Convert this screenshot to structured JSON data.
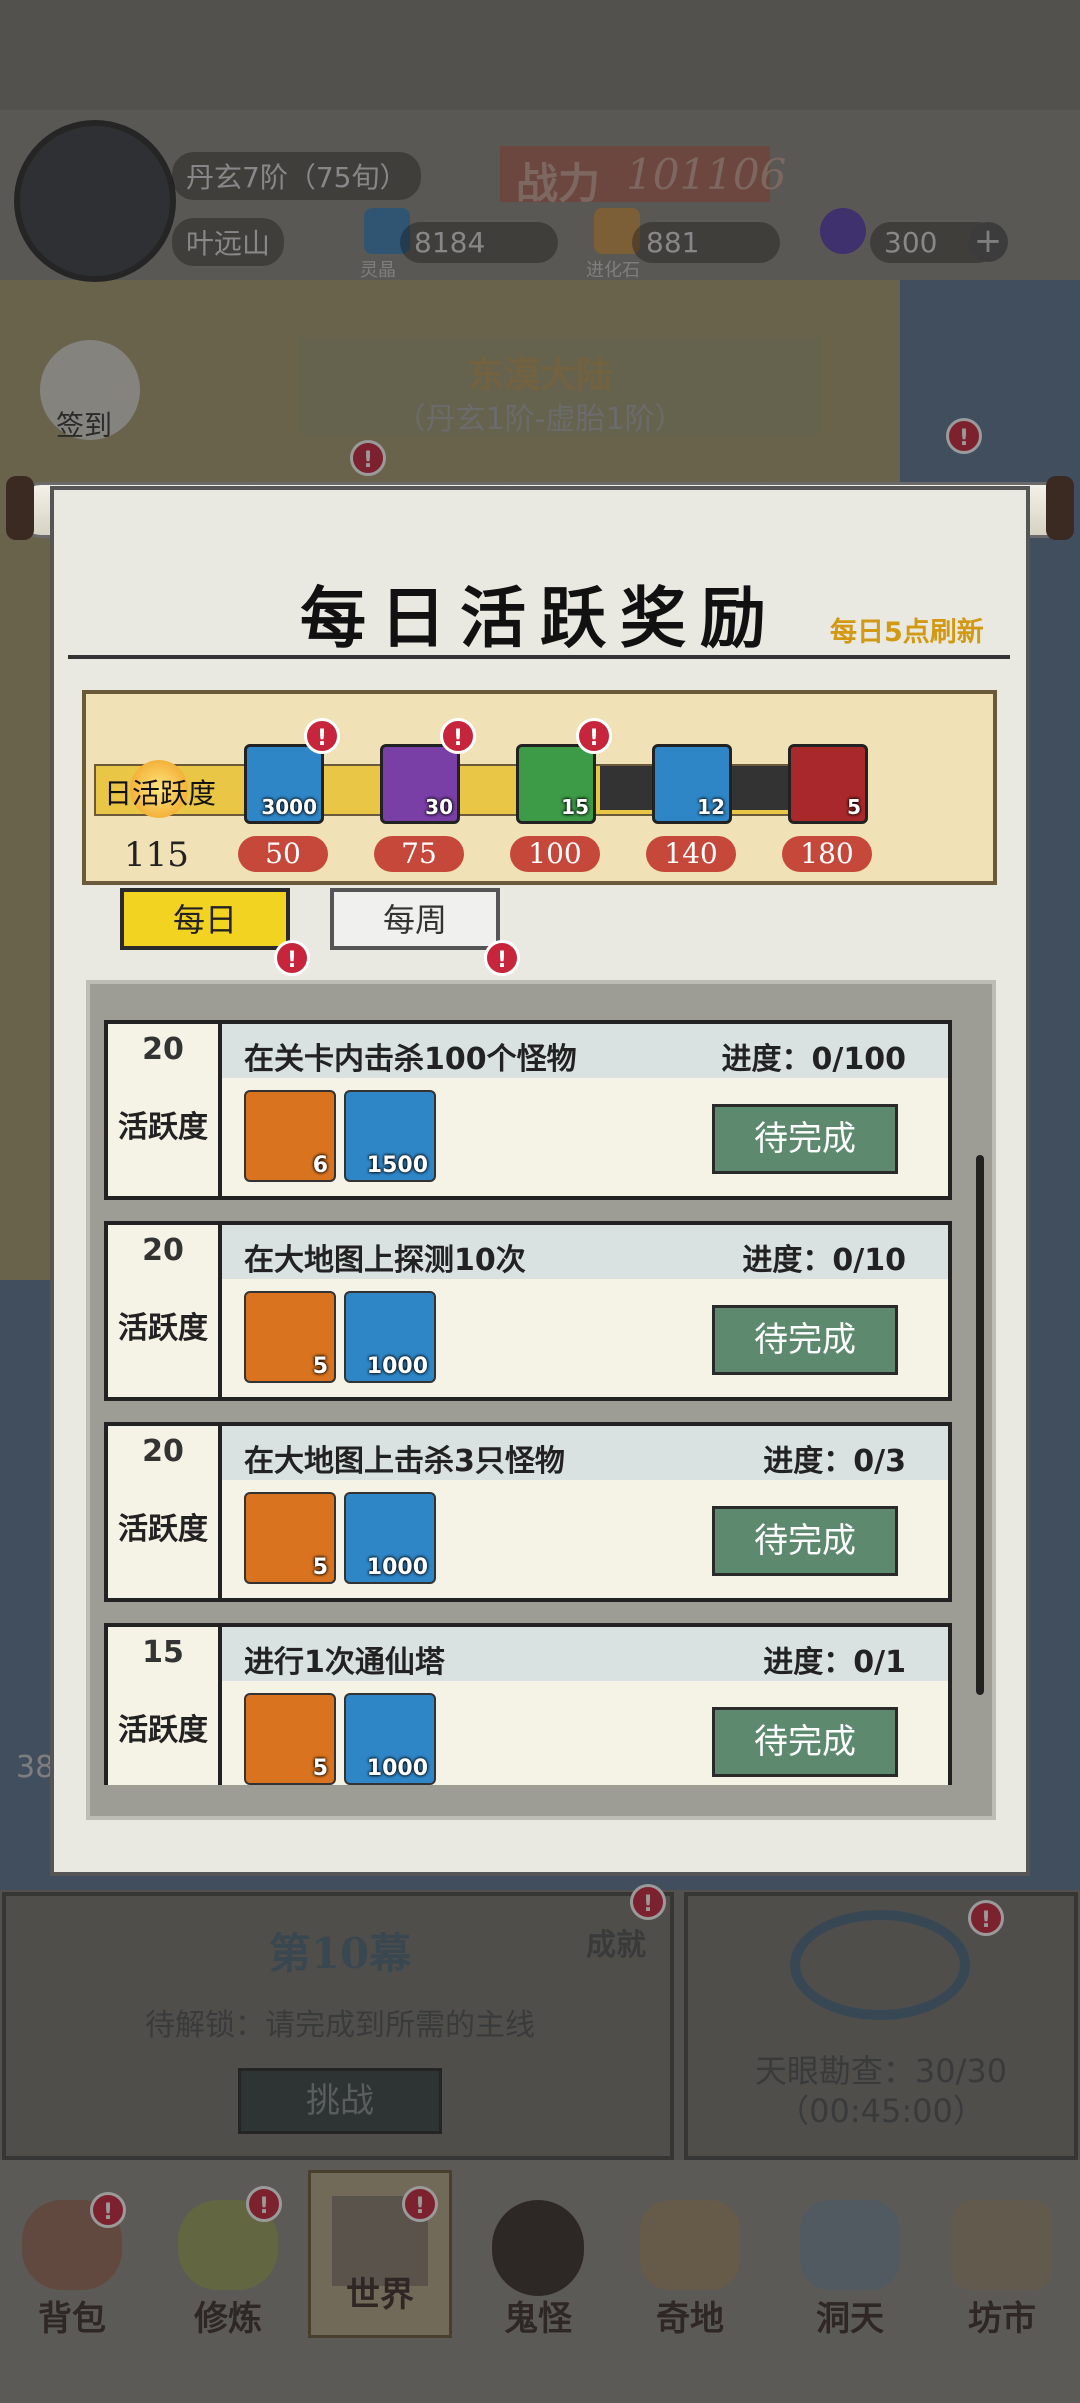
{
  "colors": {
    "accent": "#f2d321",
    "button": "#5d8a6f",
    "alert": "#c7253b",
    "threshold": "#c5483a",
    "gold": "#d29a14"
  },
  "hud": {
    "realm": "丹玄7阶（75旬）",
    "name": "叶远山",
    "power_label": "战力",
    "power_value": "101106",
    "res1_label": "灵晶",
    "res1_value": "8184",
    "res2_label": "进化石",
    "res2_value": "881",
    "res3_value": "300",
    "checkin": "签到"
  },
  "map": {
    "region": "东漠大陆",
    "region_sub": "（丹玄1阶-虚胎1阶）",
    "left_num": "38"
  },
  "modal": {
    "title": "每日活跃奖励",
    "refresh": "每日5点刷新",
    "active_label": "日活跃度",
    "active_value": "115",
    "milestones": [
      {
        "threshold": "50",
        "count": "3000",
        "icon": "crystal-icon",
        "color": "#2f86c6"
      },
      {
        "threshold": "75",
        "count": "30",
        "icon": "herb-icon",
        "color": "#7a3fa6"
      },
      {
        "threshold": "100",
        "count": "15",
        "icon": "mystery-box-icon",
        "color": "#3d9a46"
      },
      {
        "threshold": "140",
        "count": "12",
        "icon": "jade-icon",
        "color": "#2f86c6"
      },
      {
        "threshold": "180",
        "count": "5",
        "icon": "red-artifact-icon",
        "color": "#a9282b"
      }
    ],
    "tabs": {
      "daily": "每日",
      "weekly": "每周"
    },
    "tasks": [
      {
        "points": "20",
        "points_label": "活跃度",
        "name": "在关卡内击杀100个怪物",
        "progress": "进度：0/100",
        "rewards": [
          {
            "icon": "evolution-stone-icon",
            "count": "6"
          },
          {
            "icon": "crystal-icon",
            "count": "1500"
          }
        ],
        "button": "待完成"
      },
      {
        "points": "20",
        "points_label": "活跃度",
        "name": "在大地图上探测10次",
        "progress": "进度：0/10",
        "rewards": [
          {
            "icon": "evolution-stone-icon",
            "count": "5"
          },
          {
            "icon": "crystal-icon",
            "count": "1000"
          }
        ],
        "button": "待完成"
      },
      {
        "points": "20",
        "points_label": "活跃度",
        "name": "在大地图上击杀3只怪物",
        "progress": "进度：0/3",
        "rewards": [
          {
            "icon": "evolution-stone-icon",
            "count": "5"
          },
          {
            "icon": "crystal-icon",
            "count": "1000"
          }
        ],
        "button": "待完成"
      },
      {
        "points": "15",
        "points_label": "活跃度",
        "name": "进行1次通仙塔",
        "progress": "进度：0/1",
        "rewards": [
          {
            "icon": "evolution-stone-icon",
            "count": "5"
          },
          {
            "icon": "crystal-icon",
            "count": "1000"
          }
        ],
        "button": "待完成"
      }
    ]
  },
  "bottom": {
    "chapter": "第10幕",
    "locked_text": "待解锁：请完成到所需的主线",
    "challenge": "挑战",
    "achievement": "成就",
    "eye_title": "天眼勘查：30/30",
    "eye_timer": "（00:45:00）"
  },
  "nav": [
    "背包",
    "修炼",
    "世界",
    "鬼怪",
    "奇地",
    "洞天",
    "坊市"
  ]
}
